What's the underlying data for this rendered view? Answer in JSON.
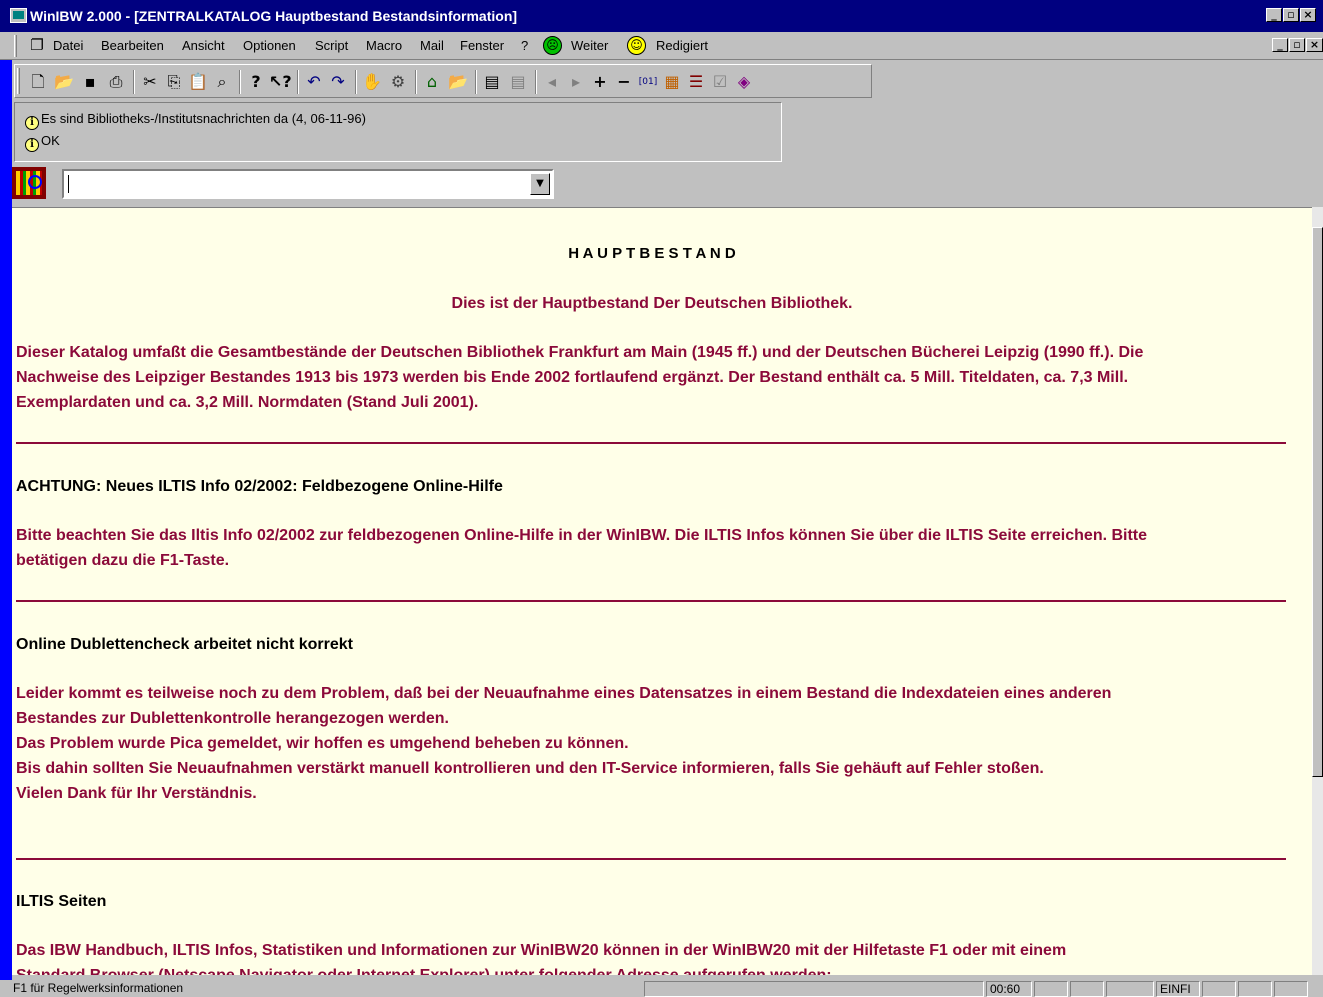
{
  "window": {
    "title": "WinIBW 2.000 - [ZENTRALKATALOG Hauptbestand Bestandsinformation]"
  },
  "menu": {
    "items": [
      "Datei",
      "Bearbeiten",
      "Ansicht",
      "Optionen",
      "Script",
      "Macro",
      "Mail",
      "Fenster",
      "?"
    ],
    "weiter": "Weiter",
    "redigiert": "Redigiert"
  },
  "toolbar": {
    "icons": [
      "new-file-icon",
      "open-folder-icon",
      "save-icon",
      "print-icon",
      "cut-icon",
      "copy-icon",
      "paste-icon",
      "find-icon",
      "help-icon",
      "context-help-icon",
      "undo-icon",
      "redo-icon",
      "stop-hand-icon",
      "connect-icon",
      "home-icon",
      "open-icon",
      "view1-icon",
      "view2-icon",
      "prev-icon",
      "next-icon",
      "plus-icon",
      "minus-icon",
      "counter-icon",
      "tool1-icon",
      "tool2-icon",
      "tool3-icon",
      "tool4-icon"
    ],
    "counter_label": "[01]"
  },
  "messages": [
    "Es sind Bibliotheks-/Institutsnachrichten da (4, 06-11-96)",
    "OK"
  ],
  "command": {
    "value": ""
  },
  "content": {
    "heading": "H A U P T B E S T A N D",
    "subheading": "Dies ist der Hauptbestand Der Deutschen Bibliothek.",
    "intro": [
      "Dieser Katalog umfaßt die Gesamtbestände der Deutschen Bibliothek Frankfurt am Main (1945 ff.) und der Deutschen Bücherei Leipzig (1990 ff.). Die",
      "Nachweise des Leipziger Bestandes 1913 bis 1973 werden bis Ende 2002 fortlaufend ergänzt. Der Bestand enthält ca. 5 Mill. Titeldaten, ca. 7,3 Mill.",
      "Exemplardaten und ca. 3,2 Mill. Normdaten (Stand Juli 2001)."
    ],
    "section1_title": "ACHTUNG: Neues ILTIS Info 02/2002: Feldbezogene Online-Hilfe",
    "section1_body": [
      "Bitte beachten Sie das Iltis Info 02/2002 zur feldbezogenen Online-Hilfe in der WinIBW. Die ILTIS Infos können Sie über die ILTIS Seite erreichen. Bitte",
      "betätigen dazu die F1-Taste."
    ],
    "section2_title": "Online Dublettencheck arbeitet nicht korrekt",
    "section2_body": [
      "Leider kommt es teilweise noch zu dem Problem, daß bei der Neuaufnahme eines Datensatzes in einem Bestand die Indexdateien eines anderen",
      "Bestandes zur Dublettenkontrolle herangezogen werden.",
      "Das Problem wurde Pica gemeldet, wir hoffen es umgehend beheben zu können.",
      "Bis dahin sollten Sie Neuaufnahmen verstärkt manuell kontrollieren und den IT-Service informieren, falls Sie gehäuft auf Fehler stoßen.",
      "Vielen Dank für Ihr Verständnis."
    ],
    "section3_title": "ILTIS Seiten",
    "section3_body": [
      "Das IBW Handbuch, ILTIS Infos, Statistiken und Informationen zur WinIBW20 können in der WinIBW20 mit der Hilfetaste F1 oder mit einem",
      "Standard Browser (Netscape Navigator oder Internet Explorer) unter folgender Adresse aufgerufen werden:"
    ]
  },
  "status": {
    "hint": "F1 für Regelwerksinformationen",
    "time": "00:60",
    "mode": "EINFI"
  },
  "colors": {
    "text": "#8b0a3a",
    "background": "#ffffe8",
    "titlebar": "#000080"
  }
}
